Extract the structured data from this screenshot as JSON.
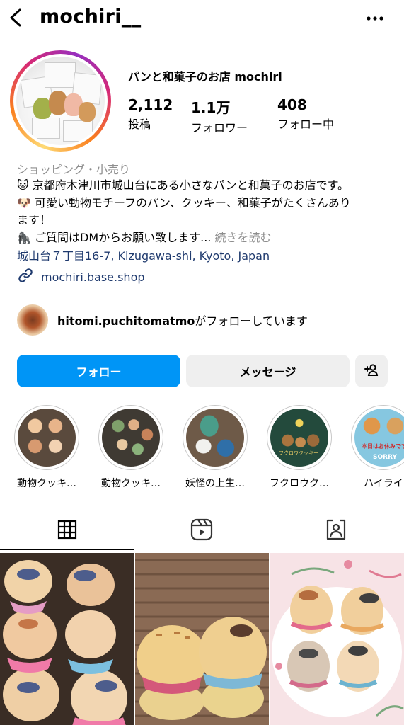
{
  "header": {
    "username": "mochiri__",
    "back_icon": "chevron-left-icon",
    "more_icon": "more-horizontal-icon"
  },
  "profile": {
    "display_name": "パンと和菓子のお店 mochiri",
    "stats": [
      {
        "value": "2,112",
        "label": "投稿"
      },
      {
        "value": "1.1万",
        "label": "フォロワー"
      },
      {
        "value": "408",
        "label": "フォロー中"
      }
    ],
    "category": "ショッピング・小売り",
    "bio_lines": [
      "🐱 京都府木津川市城山台にある小さなパンと和菓子のお店です。",
      "🐶 可愛い動物モチーフのパン、クッキー、和菓子がたくさんあり",
      "ます！",
      "🦍 ご質問はDMからお願い致します..."
    ],
    "bio_more": "続きを読む",
    "address": "城山台７丁目16-7, Kizugawa-shi, Kyoto, Japan",
    "link": "mochiri.base.shop",
    "followed_by_user": "hitomi.puchitomatmo",
    "followed_by_suffix": "がフォローしています"
  },
  "actions": {
    "follow": "フォロー",
    "message": "メッセージ"
  },
  "highlights": [
    {
      "label": "動物クッキ…"
    },
    {
      "label": "動物クッキ…"
    },
    {
      "label": "妖怪の上生…"
    },
    {
      "label": "フクロウク…"
    },
    {
      "label": "ハイライ"
    }
  ],
  "highlight_texts": {
    "sorry_top": "本日はお休みです",
    "sorry_bottom": "SORRY",
    "owl_text": "フクロウクッキー"
  },
  "tabs": [
    {
      "icon": "grid-icon",
      "active": true
    },
    {
      "icon": "reels-icon",
      "active": false
    },
    {
      "icon": "tagged-icon",
      "active": false
    }
  ],
  "colors": {
    "accent_blue": "#0095f6",
    "link_text": "#1f3a6e",
    "muted": "#8e8e8e",
    "button_gray": "#efefef"
  }
}
